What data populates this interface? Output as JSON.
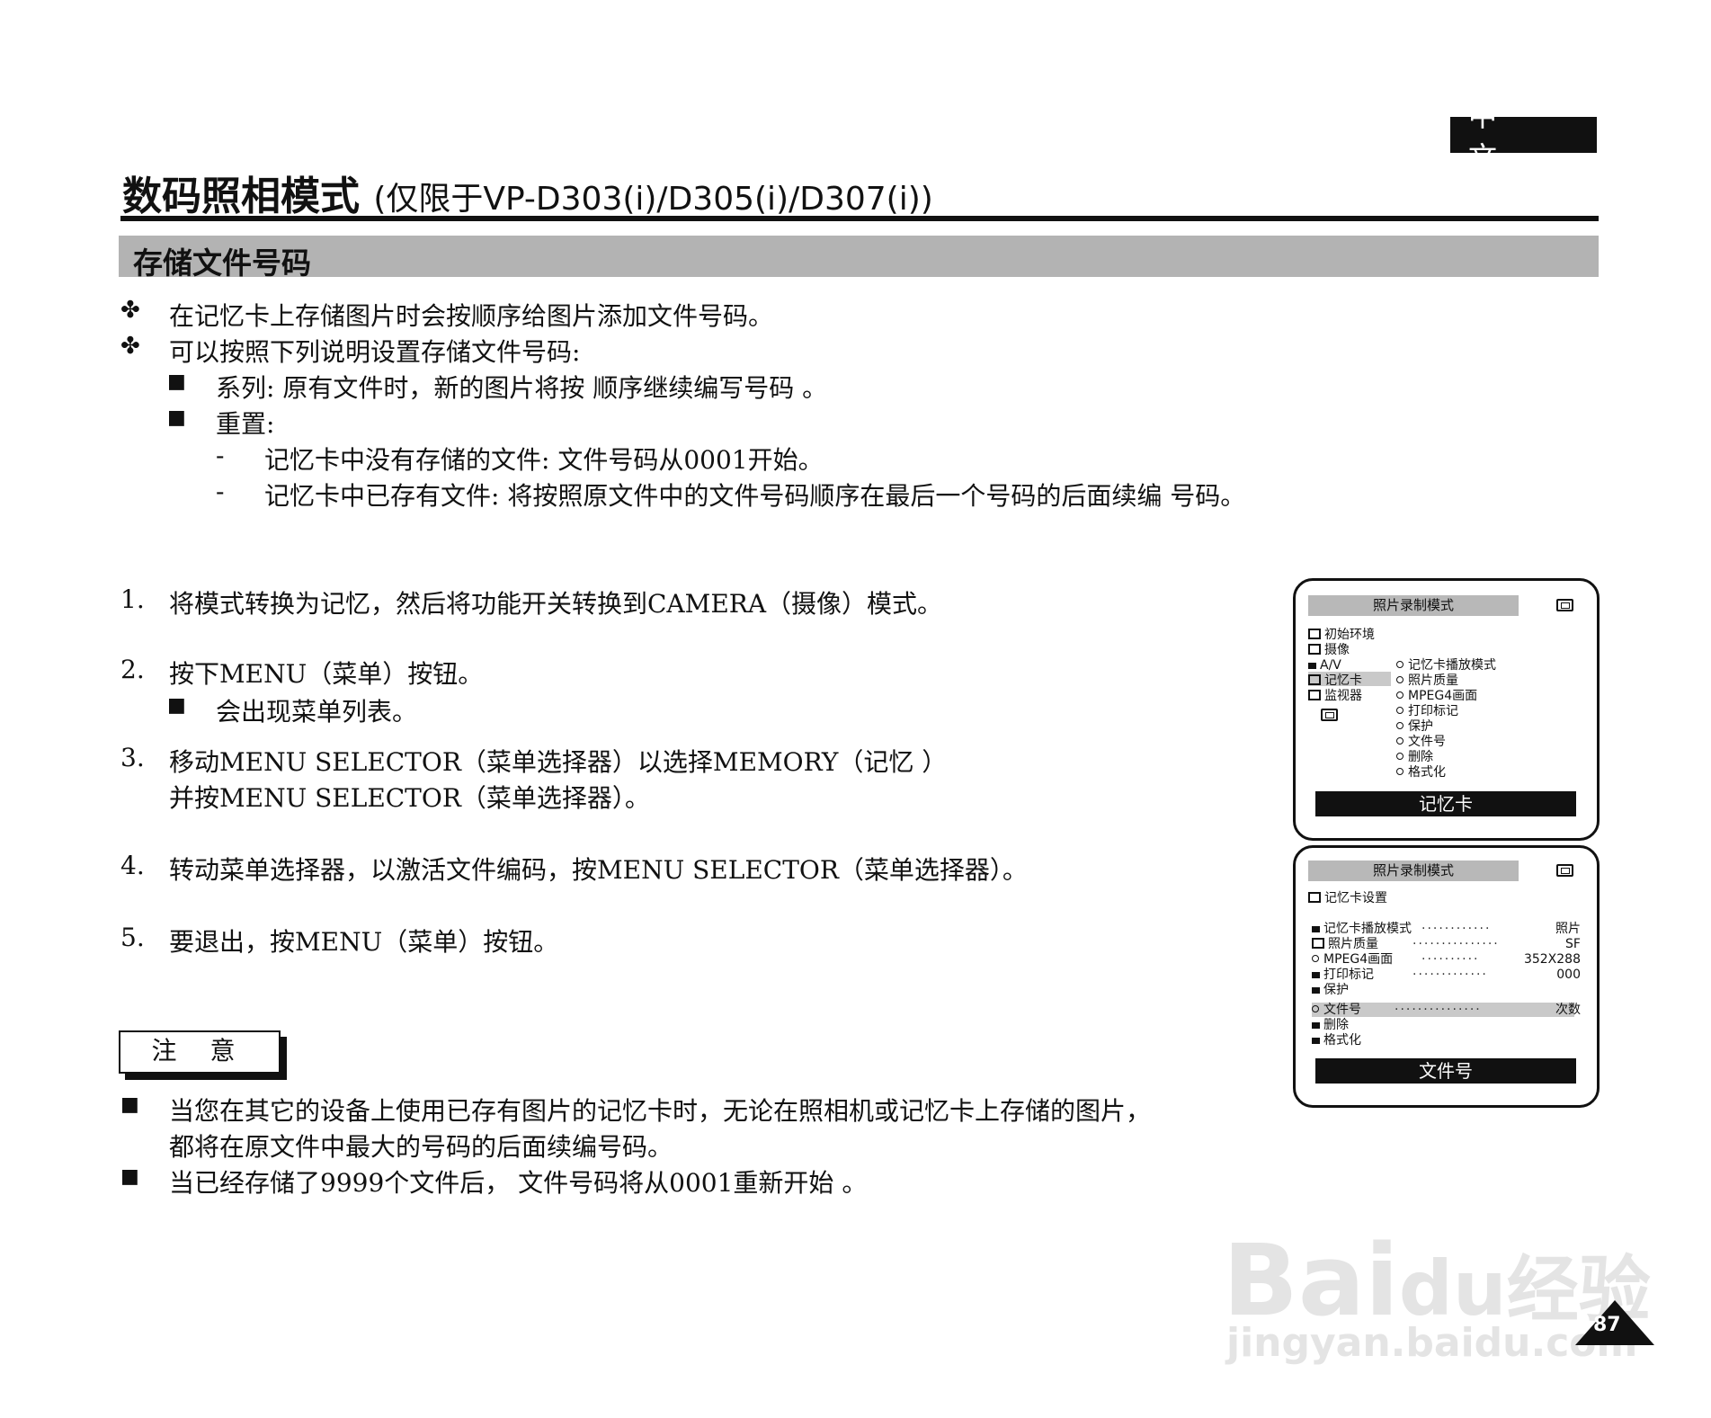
{
  "header": {
    "lang": "中 文"
  },
  "title": {
    "main": "数码照相模式",
    "sub": "(仅限于VP-D303(i)/D305(i)/D307(i))"
  },
  "section": {
    "title": "存储文件号码"
  },
  "intro": {
    "bullet_glyph": "✤",
    "square_glyph": "■",
    "dash_glyph": "-",
    "lines": [
      "在记忆卡上存储图片时会按顺序给图片添加文件号码。",
      "可以按照下列说明设置存储文件号码:"
    ],
    "sub_items": [
      "系列: 原有文件时，新的图片将按 顺序继续编写号码 。",
      "重置:"
    ],
    "dash_items": [
      "记忆卡中没有存储的文件: 文件号码从0001开始。",
      "记忆卡中已存有文件: 将按照原文件中的文件号码顺序在最后一个号码的后面续编 号码。"
    ]
  },
  "steps": [
    {
      "num": "1.",
      "text": "将模式转换为记忆，然后将功能开关转换到CAMERA（摄像）模式。"
    },
    {
      "num": "2.",
      "text": "按下MENU（菜单）按钮。",
      "sub": "会出现菜单列表。"
    },
    {
      "num": "3.",
      "text": "移动MENU SELECTOR（菜单选择器）以选择MEMORY（记忆 ）",
      "text2": "并按MENU SELECTOR（菜单选择器）。"
    },
    {
      "num": "4.",
      "text": "转动菜单选择器，以激活文件编码，按MENU SELECTOR（菜单选择器）。"
    },
    {
      "num": "5.",
      "text": "要退出，按MENU（菜单）按钮。"
    }
  ],
  "note": {
    "title": "注 意",
    "lines": [
      "当您在其它的设备上使用已存有图片的记忆卡时，无论在照相机或记忆卡上存储的图片，",
      "都将在原文件中最大的号码的后面续编号码。",
      "当已经存储了9999个文件后， 文件号码将从0001重新开始 。"
    ]
  },
  "screen1": {
    "header": "照片录制模式",
    "left_menu": [
      "初始环境",
      "摄像",
      "A/V",
      "记忆卡",
      "监视器"
    ],
    "right_menu": [
      "记忆卡播放模式",
      "照片质量",
      "MPEG4画面",
      "打印标记",
      "保护",
      "文件号",
      "删除",
      "格式化"
    ],
    "footer": "记忆卡"
  },
  "screen2": {
    "header": "照片录制模式",
    "submenu": "记忆卡设置",
    "rows": [
      {
        "label": "记忆卡播放模式",
        "value": "照片"
      },
      {
        "label": "照片质量",
        "value": "SF"
      },
      {
        "label": "MPEG4画面",
        "value": "352X288"
      },
      {
        "label": "打印标记",
        "value": "000"
      },
      {
        "label": "保护",
        "value": ""
      },
      {
        "label": "文件号",
        "value": "次数"
      },
      {
        "label": "删除",
        "value": ""
      },
      {
        "label": "格式化",
        "value": ""
      }
    ],
    "footer": "文件号"
  },
  "watermark": {
    "brand": "Bai",
    "brand2": "du",
    "cn": "经验",
    "url": "jingyan.baidu.com"
  },
  "page_number": "87"
}
